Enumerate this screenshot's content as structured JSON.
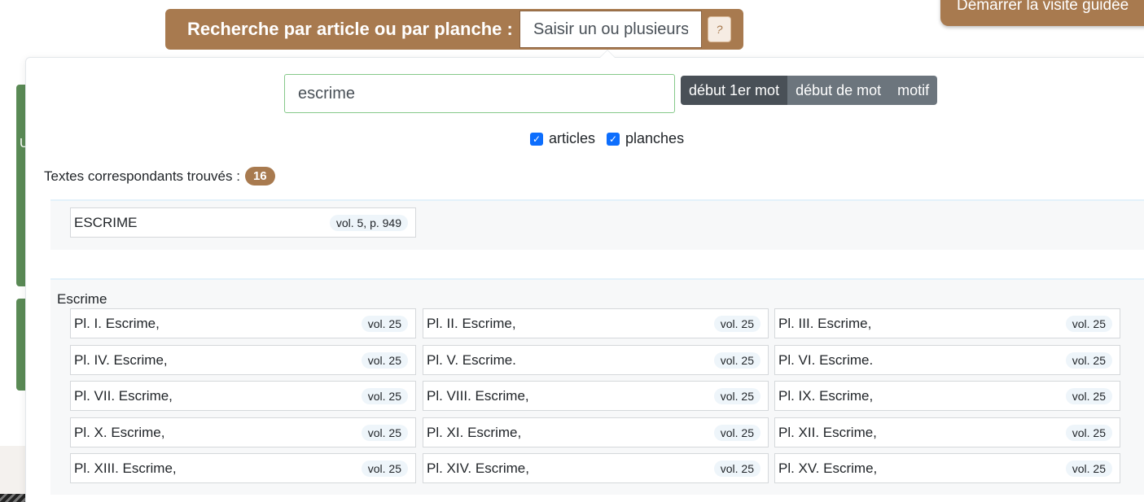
{
  "top_search": {
    "label": "Recherche par article ou par planche :",
    "input_value": "Saisir un ou plusieurs",
    "help": "?"
  },
  "tour_button": {
    "label": "Démarrer la visite guidée"
  },
  "background": {
    "letter": "U"
  },
  "popover": {
    "query": "escrime",
    "modes": [
      {
        "label": "début 1er mot",
        "active": true
      },
      {
        "label": "début de mot",
        "active": false
      },
      {
        "label": "motif",
        "active": false
      }
    ],
    "filters": [
      {
        "label": "articles",
        "checked": true
      },
      {
        "label": "planches",
        "checked": true
      }
    ],
    "results_label": "Textes correspondants trouvés :",
    "results_count": "16",
    "articles": [
      {
        "title": "ESCRIME",
        "meta": "vol. 5, p. 949"
      }
    ],
    "plate_group": "Escrime",
    "plates": [
      {
        "title": "Pl. I. Escrime,",
        "meta": "vol. 25"
      },
      {
        "title": "Pl. II. Escrime,",
        "meta": "vol. 25"
      },
      {
        "title": "Pl. III. Escrime,",
        "meta": "vol. 25"
      },
      {
        "title": "Pl. IV. Escrime,",
        "meta": "vol. 25"
      },
      {
        "title": "Pl. V. Escrime.",
        "meta": "vol. 25"
      },
      {
        "title": "Pl. VI. Escrime.",
        "meta": "vol. 25"
      },
      {
        "title": "Pl. VII. Escrime,",
        "meta": "vol. 25"
      },
      {
        "title": "Pl. VIII. Escrime,",
        "meta": "vol. 25"
      },
      {
        "title": "Pl. IX. Escrime,",
        "meta": "vol. 25"
      },
      {
        "title": "Pl. X. Escrime,",
        "meta": "vol. 25"
      },
      {
        "title": "Pl. XI. Escrime,",
        "meta": "vol. 25"
      },
      {
        "title": "Pl. XII. Escrime,",
        "meta": "vol. 25"
      },
      {
        "title": "Pl. XIII. Escrime,",
        "meta": "vol. 25"
      },
      {
        "title": "Pl. XIV. Escrime,",
        "meta": "vol. 25"
      },
      {
        "title": "Pl. XV. Escrime,",
        "meta": "vol. 25"
      }
    ]
  },
  "colors": {
    "brand": "#a87a4f",
    "accent_green": "#5a8a55",
    "checkbox": "#0d6efd"
  }
}
